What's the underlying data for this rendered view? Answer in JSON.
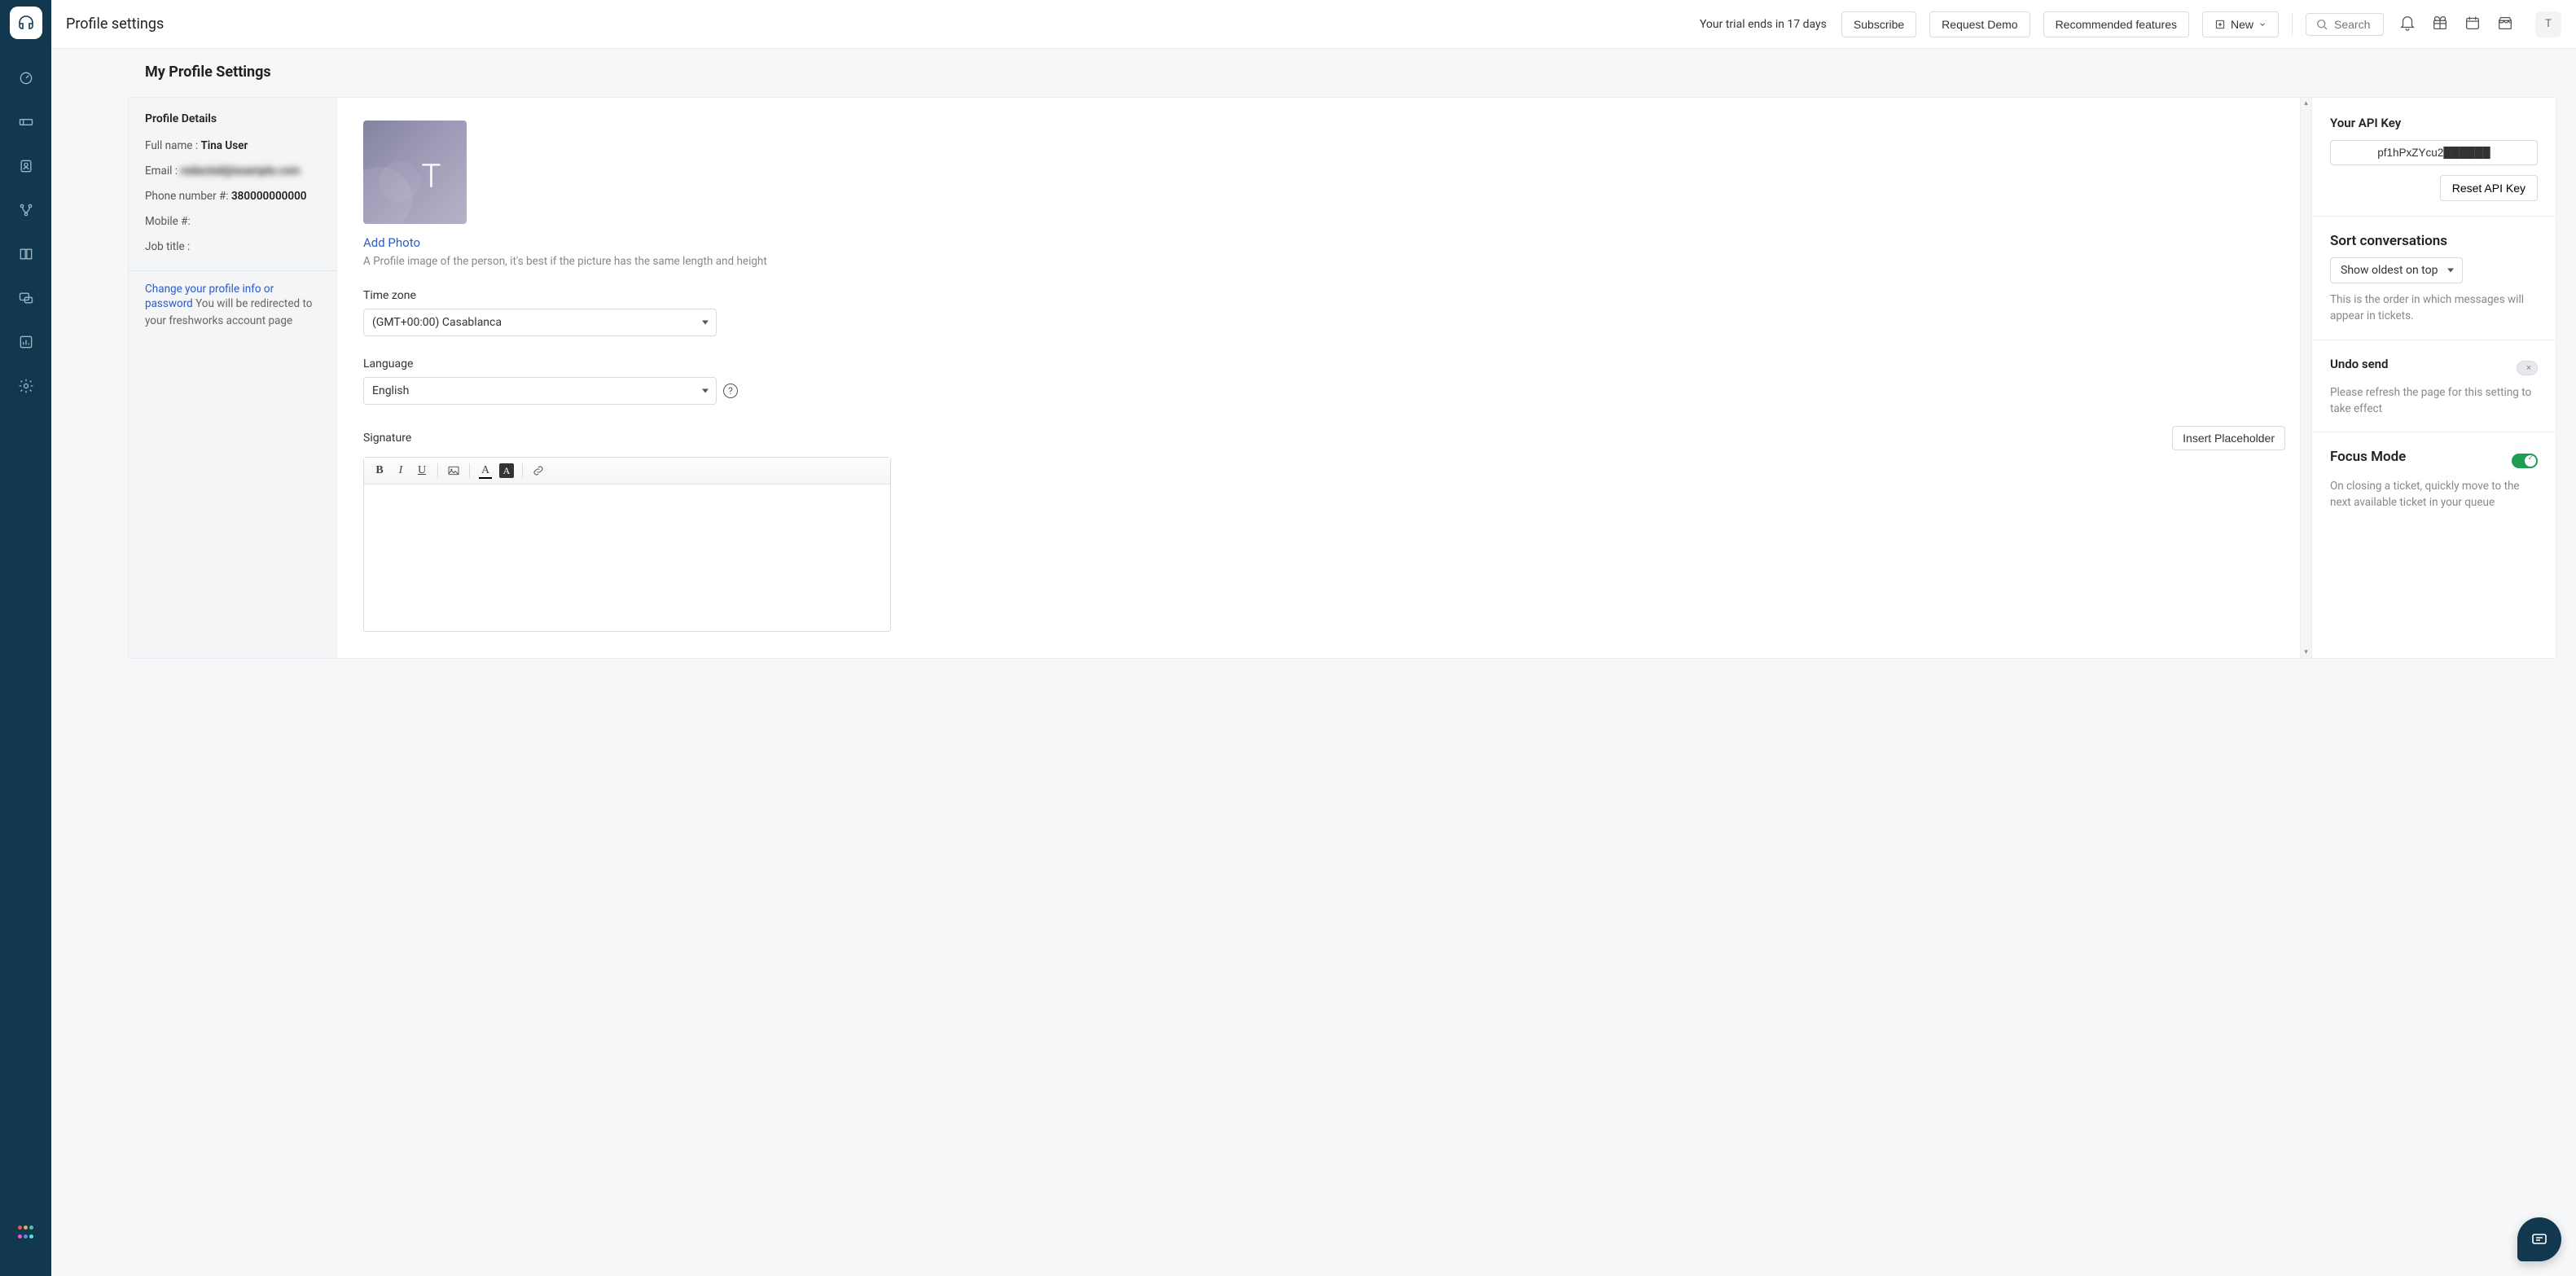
{
  "header": {
    "title": "Profile settings",
    "trial_msg": "Your trial ends in 17 days",
    "subscribe_label": "Subscribe",
    "request_demo_label": "Request Demo",
    "recommended_label": "Recommended features",
    "new_label": "New",
    "search_placeholder": "Search",
    "avatar_initial": "T"
  },
  "page_title": "My Profile Settings",
  "profile_details": {
    "heading": "Profile Details",
    "full_name_label": "Full name :",
    "full_name_value": "Tina User",
    "email_label": "Email :",
    "email_value": "redacted@example.com",
    "phone_label": "Phone number #:",
    "phone_value": "380000000000",
    "mobile_label": "Mobile #:",
    "mobile_value": "",
    "job_label": "Job title :",
    "job_value": "",
    "change_link": "Change your profile info or password",
    "change_text": " You will be redirected to your freshworks account page"
  },
  "center": {
    "profile_initial": "T",
    "add_photo_label": "Add Photo",
    "photo_hint": "A Profile image of the person, it's best if the picture has the same length and height",
    "timezone_label": "Time zone",
    "timezone_value": "(GMT+00:00) Casablanca",
    "language_label": "Language",
    "language_value": "English",
    "signature_label": "Signature",
    "insert_placeholder_label": "Insert Placeholder"
  },
  "right": {
    "api_heading": "Your API Key",
    "api_value": "pf1hPxZYcu2██████",
    "reset_label": "Reset API Key",
    "sort_heading": "Sort conversations",
    "sort_value": "Show oldest on top",
    "sort_desc": "This is the order in which messages will appear in tickets.",
    "undo_heading": "Undo send",
    "undo_desc": "Please refresh the page for this setting to take effect",
    "focus_heading": "Focus Mode",
    "focus_desc": "On closing a ticket, quickly move to the next available ticket in your queue"
  }
}
